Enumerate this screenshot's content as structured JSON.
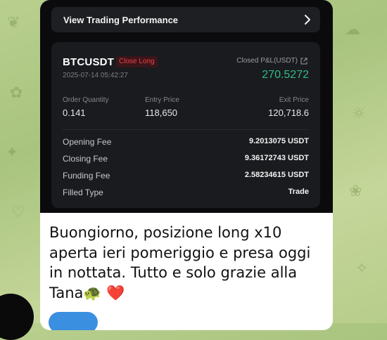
{
  "colors": {
    "chat_background": "#b9cf8e",
    "accent_green": "#2ebd85",
    "close_long_red": "#f0404a",
    "reaction_blue": "#3b8fe0"
  },
  "header": {
    "title": "View Trading Performance",
    "chevron_icon": "chevron-right-icon"
  },
  "trade": {
    "symbol": "BTCUSDT",
    "tag": "Close Long",
    "timestamp": "2025-07-14 05:42:27",
    "pnl_label": "Closed P&L(USDT)",
    "pnl_icon": "external-link-icon",
    "pnl_value": "270.5272",
    "columns": [
      {
        "label": "Order Quantity",
        "value": "0.141"
      },
      {
        "label": "Entry Price",
        "value": "118,650"
      },
      {
        "label": "Exit Price",
        "value": "120,718.6"
      }
    ],
    "rows": [
      {
        "label": "Opening Fee",
        "value": "9.2013075 USDT"
      },
      {
        "label": "Closing Fee",
        "value": "9.36172743 USDT"
      },
      {
        "label": "Funding Fee",
        "value": "2.58234615 USDT"
      },
      {
        "label": "Filled Type",
        "value": "Trade"
      }
    ]
  },
  "message": {
    "text": "Buongiorno, posizione long x10 aperta ieri pomeriggio e presa oggi in nottata. Tutto e solo grazie alla Tana",
    "emoji_1": "🐢",
    "emoji_2": "❤️"
  }
}
